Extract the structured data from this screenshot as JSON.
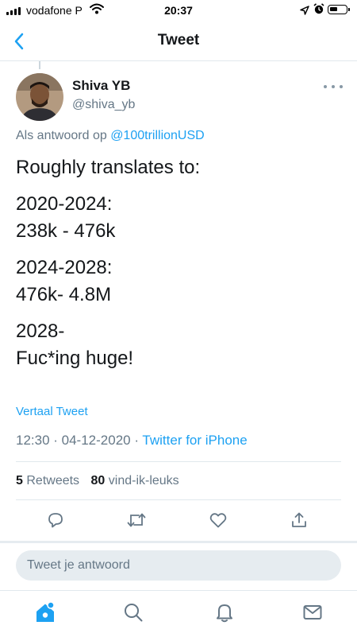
{
  "status_bar": {
    "carrier": "vodafone P",
    "time": "20:37",
    "icons": [
      "signal-icon",
      "wifi-icon",
      "location-icon",
      "alarm-icon",
      "battery-icon"
    ]
  },
  "nav": {
    "title": "Tweet",
    "back_icon": "chevron-left-icon"
  },
  "tweet": {
    "author": {
      "name": "Shiva YB",
      "handle": "@shiva_yb"
    },
    "reply_to": {
      "prefix": "Als antwoord op",
      "user": "@100trillionUSD"
    },
    "body": [
      "Roughly translates to:",
      "2020-2024:",
      "238k - 476k",
      "2024-2028:",
      "476k- 4.8M",
      "2028-",
      "Fuc*ing huge!"
    ],
    "translate_label": "Vertaal Tweet",
    "timestamp": "12:30 · 04-12-2020 ·",
    "source": "Twitter for iPhone",
    "stats": {
      "retweets_count": "5",
      "retweets_label": "Retweets",
      "likes_count": "80",
      "likes_label": "vind-ik-leuks"
    }
  },
  "actions": [
    "reply-icon",
    "retweet-icon",
    "like-icon",
    "share-icon"
  ],
  "reply_box": {
    "placeholder": "Tweet je antwoord"
  },
  "tab_bar": {
    "items": [
      "home-icon",
      "search-icon",
      "notifications-icon",
      "messages-icon"
    ],
    "active": "home-icon"
  },
  "colors": {
    "accent": "#1da1f2",
    "text": "#14171a",
    "secondary": "#657786",
    "divider": "#e1e8ed"
  }
}
